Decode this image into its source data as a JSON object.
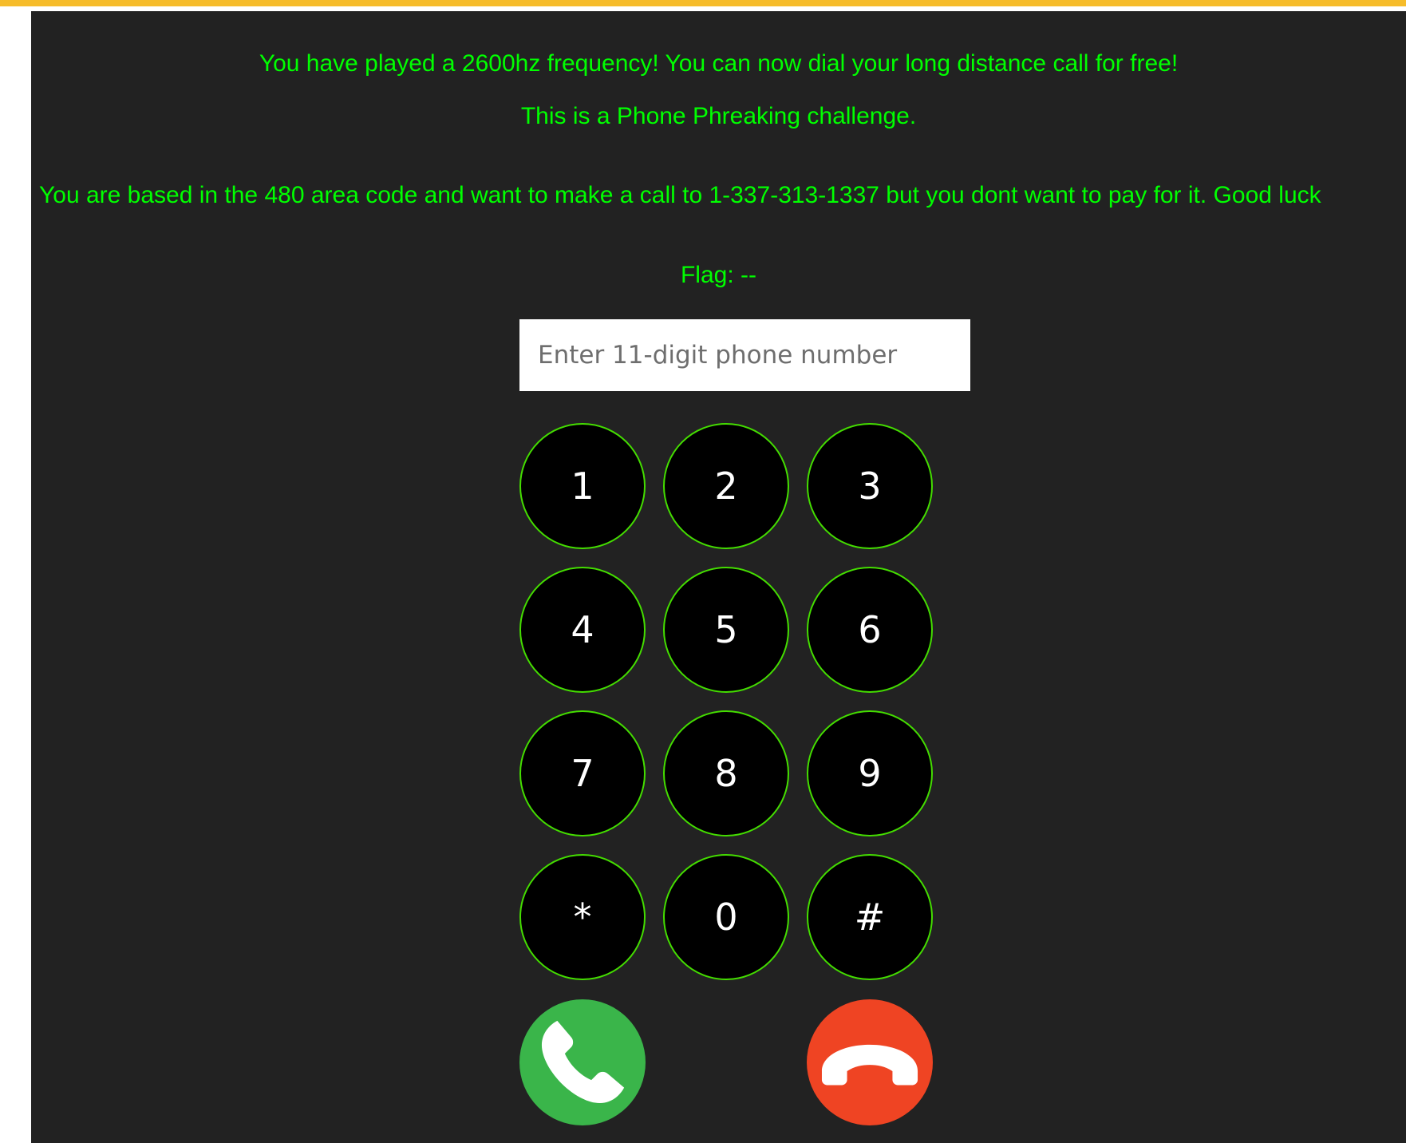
{
  "messages": {
    "frequency": "You have played a 2600hz frequency! You can now dial your long distance call for free!",
    "challenge": "This is a Phone Phreaking challenge.",
    "scenario": "You are based in the 480 area code and want to make a call to 1-337-313-1337 but you dont want to pay for it. Good luck",
    "flag": "Flag: --"
  },
  "phone_input": {
    "value": "",
    "placeholder": "Enter 11-digit phone number"
  },
  "keypad": {
    "keys": [
      "1",
      "2",
      "3",
      "4",
      "5",
      "6",
      "7",
      "8",
      "9",
      "*",
      "0",
      "#"
    ]
  },
  "actions": {
    "call_icon": "phone-call-icon",
    "hangup_icon": "phone-hangup-icon"
  },
  "colors": {
    "text_accent": "#00ff00",
    "key_border": "#44dd00",
    "call_green": "#3ab54a",
    "hangup_red": "#ef4423",
    "panel_bg": "#222222",
    "top_strip": "#f6bc2a"
  }
}
